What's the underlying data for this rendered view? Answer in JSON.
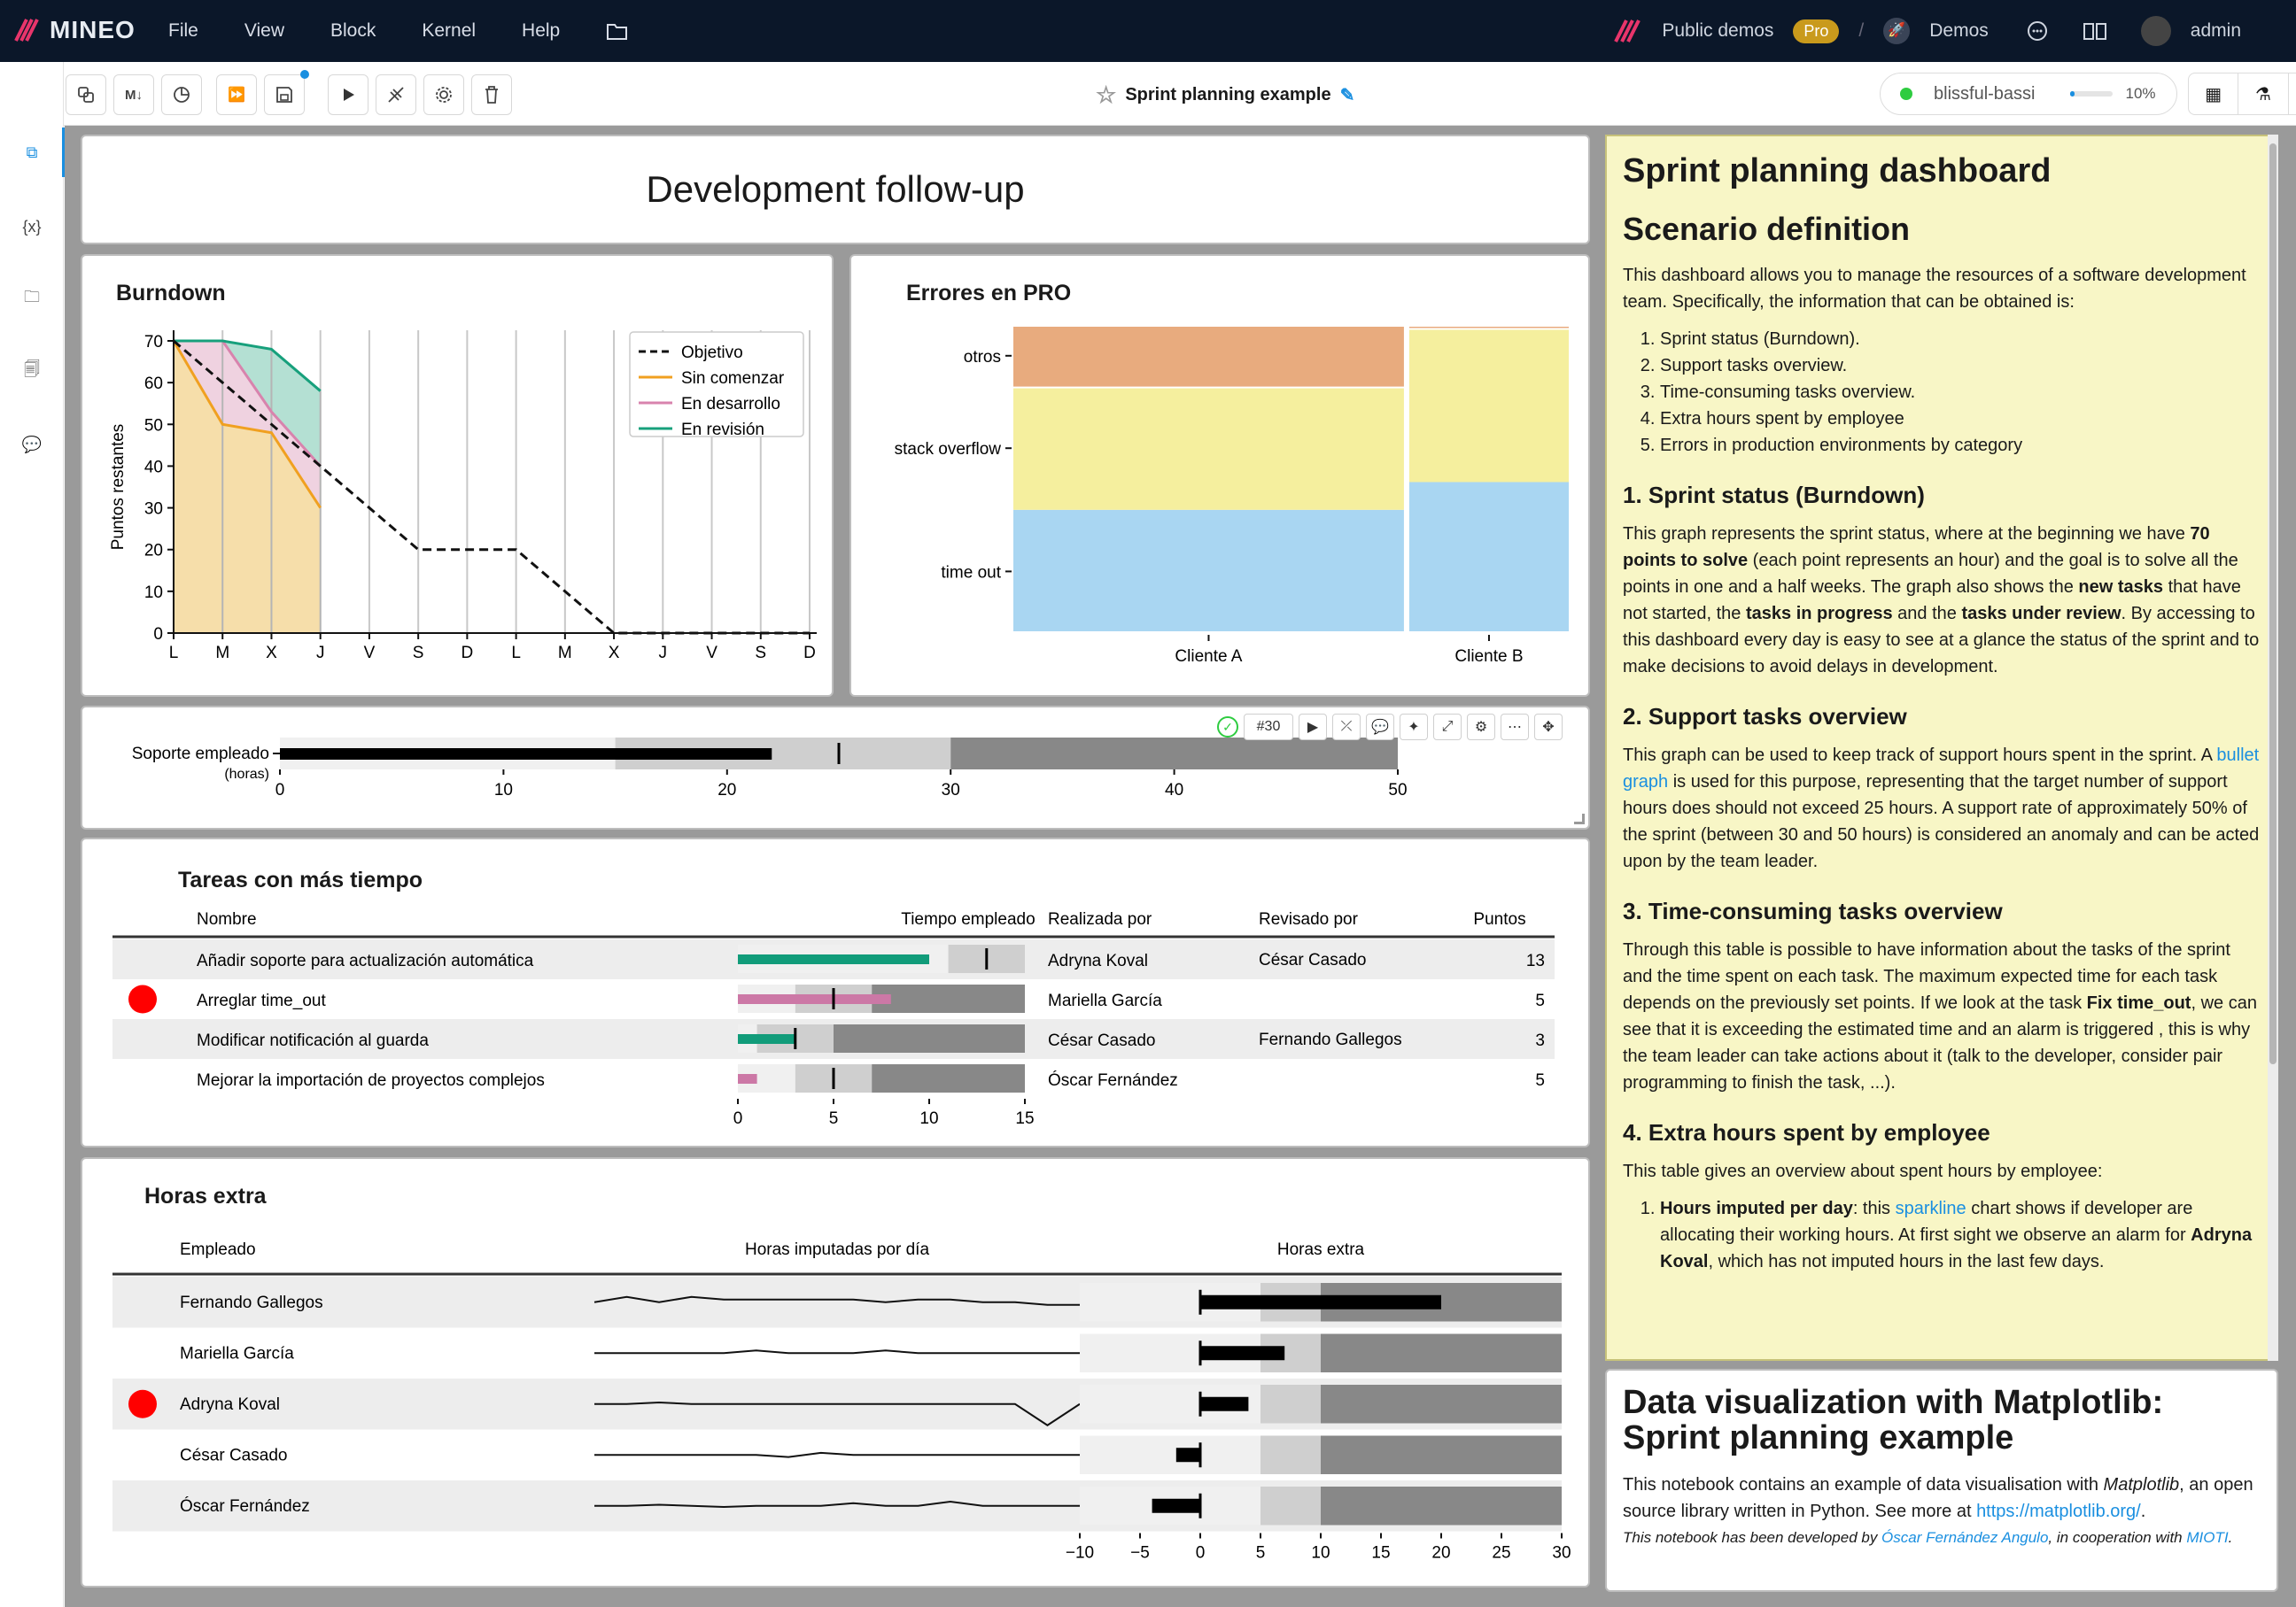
{
  "app": {
    "name": "MINEO",
    "menu": [
      "File",
      "View",
      "Block",
      "Kernel",
      "Help"
    ],
    "public_demos": "Public demos",
    "pro_badge": "Pro",
    "demos": "Demos",
    "user": "admin"
  },
  "toolbar": {
    "notebook_title": "Sprint planning example",
    "kernel_name": "blissful-bassi",
    "kernel_usage": "10%"
  },
  "dashboard": {
    "title": "Development follow-up"
  },
  "burndown": {
    "title": "Burndown",
    "ylabel": "Puntos restantes",
    "legend": [
      "Objetivo",
      "Sin comenzar",
      "En desarrollo",
      "En revisión"
    ],
    "chart_data": {
      "type": "area",
      "categories": [
        "L",
        "M",
        "X",
        "J",
        "V",
        "S",
        "D",
        "L",
        "M",
        "X",
        "J",
        "V",
        "S",
        "D"
      ],
      "ylim": [
        0,
        70
      ],
      "yticks": [
        0,
        10,
        20,
        30,
        40,
        50,
        60,
        70
      ],
      "series": [
        {
          "name": "Objetivo",
          "values": [
            70,
            60,
            50,
            40,
            30,
            20,
            20,
            20,
            10,
            0,
            0,
            0,
            0,
            0
          ]
        },
        {
          "name": "Sin comenzar",
          "values": [
            70,
            50,
            48,
            30
          ]
        },
        {
          "name": "En desarrollo",
          "values": [
            70,
            70,
            53,
            40
          ]
        },
        {
          "name": "En revisión",
          "values": [
            70,
            70,
            68,
            58
          ]
        }
      ]
    }
  },
  "errores": {
    "title": "Errores en PRO",
    "chart_data": {
      "type": "mosaic",
      "x_categories": [
        "Cliente A",
        "Cliente B"
      ],
      "x_shares": [
        0.71,
        0.29
      ],
      "y_categories": [
        "time out",
        "stack overflow",
        "otros"
      ],
      "shares": {
        "Cliente A": [
          0.4,
          0.4,
          0.2
        ],
        "Cliente B": [
          0.49,
          0.5,
          0.01
        ]
      },
      "colors": [
        "#a9d6f2",
        "#f5ef9e",
        "#e8ab7e"
      ]
    }
  },
  "soporte": {
    "label": "Soporte empleado",
    "sublabel": "(horas)",
    "chart_data": {
      "type": "bullet",
      "value": 22,
      "target": 25,
      "ranges": [
        15,
        30,
        50
      ],
      "xticks": [
        0,
        10,
        20,
        30,
        40,
        50
      ]
    },
    "cell_number": "#30"
  },
  "tareas": {
    "title": "Tareas con más tiempo",
    "headers": [
      "Nombre",
      "Tiempo empleado",
      "Realizada por",
      "Revisado por",
      "Puntos"
    ],
    "rows": [
      {
        "nombre": "Añadir soporte para actualización automática",
        "realizada": "Adryna Koval",
        "revisado": "César Casado",
        "puntos": "13",
        "alarm": false,
        "value": 10,
        "target": 13,
        "ranges": [
          11,
          15,
          15
        ],
        "color": "#119c7a"
      },
      {
        "nombre": "Arreglar time_out",
        "realizada": "Mariella García",
        "revisado": "",
        "puntos": "5",
        "alarm": true,
        "value": 8,
        "target": 5,
        "ranges": [
          3,
          7,
          15
        ],
        "color": "#cc78a6"
      },
      {
        "nombre": "Modificar notificación al guarda",
        "realizada": "César Casado",
        "revisado": "Fernando Gallegos",
        "puntos": "3",
        "alarm": false,
        "value": 3,
        "target": 3,
        "ranges": [
          1,
          5,
          15
        ],
        "color": "#119c7a"
      },
      {
        "nombre": "Mejorar la importación de proyectos complejos",
        "realizada": "Óscar Fernández",
        "revisado": "",
        "puntos": "5",
        "alarm": false,
        "value": 1,
        "target": 5,
        "ranges": [
          3,
          7,
          15
        ],
        "color": "#cc78a6"
      }
    ],
    "xticks": [
      "0",
      "5",
      "10",
      "15"
    ]
  },
  "horas": {
    "title": "Horas extra",
    "headers": [
      "Empleado",
      "Horas imputadas por día",
      "Horas extra"
    ],
    "rows": [
      {
        "empleado": "Fernando Gallegos",
        "alarm": false,
        "extra": 20,
        "spark": [
          8,
          9,
          8,
          9,
          8.5,
          8.5,
          8.5,
          8.5,
          8.5,
          8,
          8.5,
          8.5,
          8,
          8,
          7.5,
          7.5
        ]
      },
      {
        "empleado": "Mariella García",
        "alarm": false,
        "extra": 7,
        "spark": [
          8,
          8,
          8,
          8,
          8,
          8.5,
          8,
          8,
          8,
          8.5,
          8,
          8,
          8,
          8,
          8,
          8
        ]
      },
      {
        "empleado": "Adryna Koval",
        "alarm": true,
        "extra": 4,
        "spark": [
          8,
          8,
          8.3,
          8,
          8,
          8,
          8,
          8,
          8,
          8,
          8,
          8,
          8,
          8,
          4,
          8
        ]
      },
      {
        "empleado": "César Casado",
        "alarm": false,
        "extra": -2,
        "spark": [
          8,
          8,
          8,
          8,
          8,
          8,
          7.6,
          8.4,
          8,
          8,
          8,
          8,
          8,
          8,
          8,
          8
        ]
      },
      {
        "empleado": "Óscar Fernández",
        "alarm": false,
        "extra": -4,
        "spark": [
          8,
          8,
          8.2,
          8,
          7.8,
          8,
          8,
          8,
          8.5,
          8,
          8,
          8.8,
          8,
          8,
          8,
          8
        ]
      }
    ],
    "xticks": [
      "−10",
      "−5",
      "0",
      "5",
      "10",
      "15",
      "20",
      "25",
      "30"
    ]
  },
  "notes": {
    "h1": "Sprint planning dashboard",
    "h2": "Scenario definition",
    "intro": "This dashboard allows you to manage the resources of a software development team. Specifically, the information that can be obtained is:",
    "list": [
      "Sprint status (Burndown).",
      "Support tasks overview.",
      "Time-consuming tasks overview.",
      "Extra hours spent by employee",
      "Errors in production environments by category"
    ],
    "s1_title": "1. Sprint status (Burndown)",
    "s1_a": "This graph represents the sprint status, where at the beginning we have ",
    "s1_b": "70 points to solve",
    "s1_c": " (each point represents an hour) and the goal is to solve all the points in one and a half weeks. The graph also shows the ",
    "s1_d": "new tasks",
    "s1_e": " that have not started, the ",
    "s1_f": "tasks in progress",
    "s1_g": " and the ",
    "s1_h": "tasks under review",
    "s1_i": ". By accessing to this dashboard every day is easy to see at a glance the status of the sprint and to make decisions to avoid delays in development.",
    "s2_title": "2. Support tasks overview",
    "s2_a": "This graph can be used to keep track of support hours spent in the sprint. A ",
    "s2_link": "bullet graph",
    "s2_b": " is used for this purpose, representing that the target number of support hours does should not exceed 25 hours. A support rate of approximately 50% of the sprint (between 30 and 50 hours) is considered an anomaly and can be acted upon by the team leader.",
    "s3_title": "3. Time-consuming tasks overview",
    "s3_a": "Through this table is possible to have information about the tasks of the sprint and the time spent on each task. The maximum expected time for each task depends on the previously set points. If we look at the task ",
    "s3_b": "Fix time_out",
    "s3_c": ", we can see that it is exceeding the estimated time and an alarm is triggered , this is why the team leader can take actions about it (talk to the developer, consider pair programming to finish the task, ...).",
    "s4_title": "4. Extra hours spent by employee",
    "s4_a": "This table gives an overview about spent hours by employee:",
    "s4_li_b": "Hours imputed per day",
    "s4_li_a": ": this ",
    "s4_li_link": "sparkline",
    "s4_li_c": " chart shows if developer are allocating their working hours. At first sight we observe an alarm for ",
    "s4_li_d": "Adryna Koval",
    "s4_li_e": ", which has not imputed hours in the last few days."
  },
  "about": {
    "title": "Data visualization with Matplotlib: Sprint planning example",
    "p1_a": "This notebook contains an example of data visualisation with ",
    "p1_em": "Matplotlib",
    "p1_b": ", an open source library written in Python. See more at ",
    "p1_link": "https://matplotlib.org/",
    "p1_c": ".",
    "p2_a": "This notebook has been developed by ",
    "p2_link1": "Óscar Fernández Angulo",
    "p2_b": ", in cooperation with ",
    "p2_link2": "MIOTI",
    "p2_c": "."
  }
}
